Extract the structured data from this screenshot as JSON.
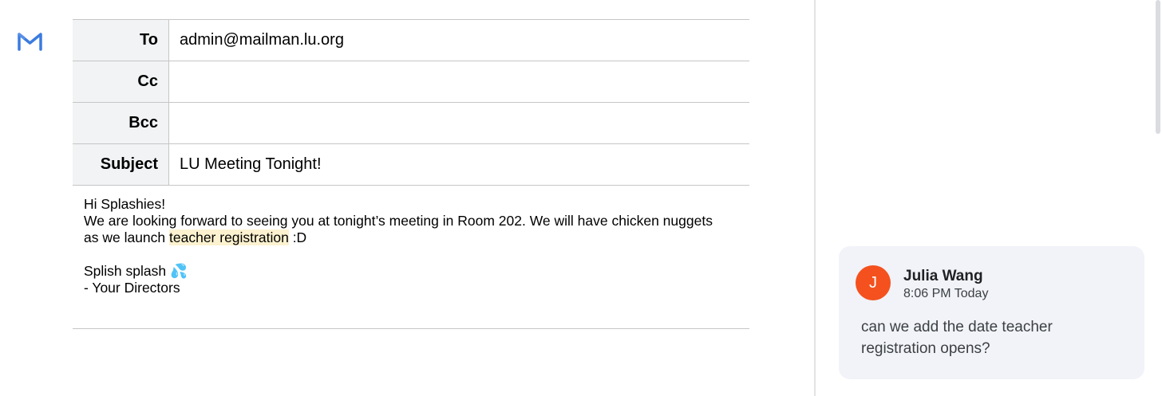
{
  "app": {
    "logo_icon": "gmail-icon",
    "accent": "#4285f4"
  },
  "mail": {
    "fields": {
      "to_label": "To",
      "to_value": "admin@mailman.lu.org",
      "cc_label": "Cc",
      "cc_value": "",
      "bcc_label": "Bcc",
      "bcc_value": "",
      "subject_label": "Subject",
      "subject_value": "LU Meeting Tonight!"
    },
    "body": {
      "greeting": "Hi Splashies!",
      "line1": "We are looking forward to seeing you at tonight’s meeting in Room 202. We will have chicken nuggets",
      "line2_before": "as we launch ",
      "line2_highlight": "teacher registration",
      "line2_after": " :D",
      "signoff": "Splish splash 💦",
      "signature": "- Your Directors"
    }
  },
  "comment": {
    "avatar_initial": "J",
    "avatar_color": "#f4511e",
    "author": "Julia Wang",
    "time": "8:06 PM Today",
    "text": "can we add the date teacher registration opens?"
  }
}
